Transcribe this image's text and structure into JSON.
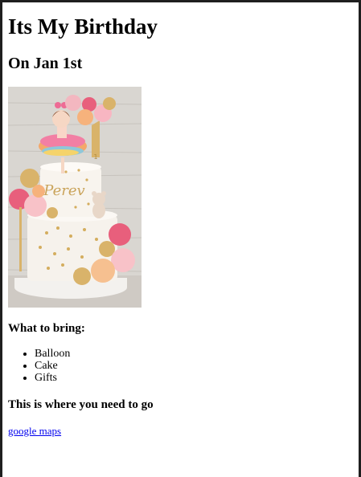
{
  "page": {
    "title": "Its My Birthday",
    "subtitle": "On Jan 1st",
    "cake_image": {
      "icon": "birthday-cake-photo",
      "topper_text": "Perev",
      "candle_number": "1"
    },
    "bring_heading": "What to bring:",
    "bring_items": [
      "Balloon",
      "Cake",
      "Gifts"
    ],
    "directions_heading": "This is where you need to go",
    "maps_link_text": "google maps"
  }
}
